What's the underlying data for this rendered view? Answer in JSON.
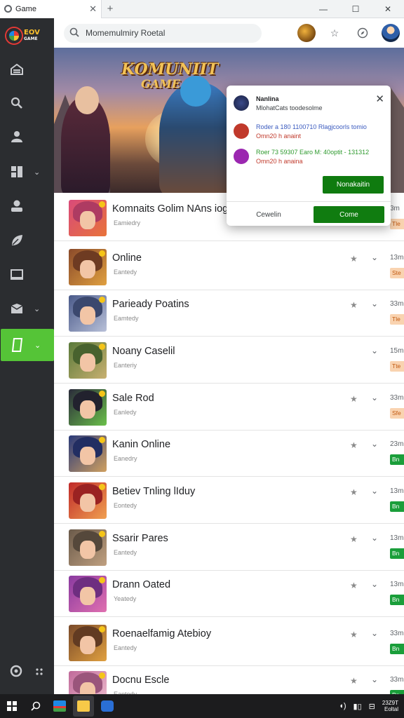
{
  "browser": {
    "tab_title": "Game",
    "new_tab_label": "+",
    "window_controls": [
      "—",
      "☐",
      "✕"
    ]
  },
  "sidebar": {
    "logo_text": "EOV",
    "logo_subtext": "GAME",
    "items": [
      {
        "name": "home",
        "icon": "home-icon",
        "has_chevron": false
      },
      {
        "name": "search",
        "icon": "search-icon",
        "has_chevron": false
      },
      {
        "name": "profile",
        "icon": "users-icon",
        "has_chevron": false
      },
      {
        "name": "library",
        "icon": "grid-icon",
        "has_chevron": true
      },
      {
        "name": "account",
        "icon": "user-icon",
        "has_chevron": false
      },
      {
        "name": "discover",
        "icon": "leaf-icon",
        "has_chevron": false
      },
      {
        "name": "display",
        "icon": "monitor-icon",
        "has_chevron": false
      },
      {
        "name": "inbox",
        "icon": "mail-icon",
        "has_chevron": true
      },
      {
        "name": "games",
        "icon": "bookmark-icon",
        "has_chevron": true,
        "active": true
      }
    ],
    "accent_color": "#55c437"
  },
  "search": {
    "value": "Momemulmiry Roetal"
  },
  "hero": {
    "title": "KOMUNIIT",
    "subtitle": "GAME"
  },
  "games": [
    {
      "title": "Komnaits Golim NAns iog",
      "subtitle": "Eamiedry",
      "time": "3m",
      "tag": "Tle",
      "tag_color": "orange",
      "starred": false,
      "palette": [
        "#d94a7a",
        "#e8733a"
      ]
    },
    {
      "title": "Online",
      "subtitle": "Eantedy",
      "time": "13m",
      "tag": "Ste",
      "tag_color": "orange",
      "starred": true,
      "palette": [
        "#8a4a2a",
        "#e0a040"
      ]
    },
    {
      "title": "Parieady Poatins",
      "subtitle": "Eamtedy",
      "time": "33m",
      "tag": "Tle",
      "tag_color": "orange",
      "starred": true,
      "palette": [
        "#4a5a8a",
        "#b8c0d8"
      ]
    },
    {
      "title": "Noany Caselil",
      "subtitle": "Eanteriy",
      "time": "15m",
      "tag": "Tte",
      "tag_color": "orange",
      "starred": false,
      "palette": [
        "#5a7a3a",
        "#c8b070"
      ]
    },
    {
      "title": "Sale Rod",
      "subtitle": "Eanledy",
      "time": "33m",
      "tag": "Sfe",
      "tag_color": "orange",
      "starred": true,
      "palette": [
        "#2a2a3a",
        "#6ac04a"
      ]
    },
    {
      "title": "Kanin Online",
      "subtitle": "Eanedry",
      "time": "23m",
      "tag": "Bn",
      "tag_color": "green",
      "starred": true,
      "palette": [
        "#2a3a7a",
        "#d0a060"
      ]
    },
    {
      "title": "Betiev Tnling lIduy",
      "subtitle": "Eontedy",
      "time": "13m",
      "tag": "Bn",
      "tag_color": "green",
      "starred": true,
      "palette": [
        "#c02a2a",
        "#f0a050"
      ]
    },
    {
      "title": "Ssarir Pares",
      "subtitle": "Eantedy",
      "time": "13m",
      "tag": "Bn",
      "tag_color": "green",
      "starred": true,
      "palette": [
        "#6a5a4a",
        "#c0a080"
      ]
    },
    {
      "title": "Drann Oated",
      "subtitle": "Yeatedy",
      "time": "13m",
      "tag": "Bn",
      "tag_color": "green",
      "starred": true,
      "palette": [
        "#8a3aa0",
        "#e070b0"
      ]
    },
    {
      "title": "Roenaelfamig Atebioy",
      "subtitle": "Eantedy",
      "time": "33m",
      "tag": "Bn",
      "tag_color": "green",
      "starred": true,
      "palette": [
        "#7a4a2a",
        "#e0a040"
      ]
    },
    {
      "title": "Docnu Escle",
      "subtitle": "Eantedy",
      "time": "33m",
      "tag": "Bn",
      "tag_color": "green",
      "starred": true,
      "palette": [
        "#c06a9a",
        "#f0c0d0"
      ]
    }
  ],
  "popup": {
    "header": {
      "title": "Nanlina",
      "body": "MlohatCats toodesolme"
    },
    "notifications": [
      {
        "line1": "Roder a 180 1100710 Rlagjcoorls tomio",
        "line2": "Omn20 h anaint",
        "icon_color": "#c0392b",
        "line1_color": "#3b5bbf",
        "line2_color": "#c0392b"
      },
      {
        "line1": "Roer 73 59307 Earo M: 40optit - 131312",
        "line2": "Omn20 h anaina",
        "icon_color": "#9b27b0",
        "line1_color": "#2e9a2e",
        "line2_color": "#c0392b"
      }
    ],
    "primary_button": "Nonakaitin",
    "secondary_button": "Cewelin",
    "confirm_button": "Come"
  },
  "taskbar": {
    "clock_line1": "23Z9T",
    "clock_line2": "Eoltal"
  }
}
